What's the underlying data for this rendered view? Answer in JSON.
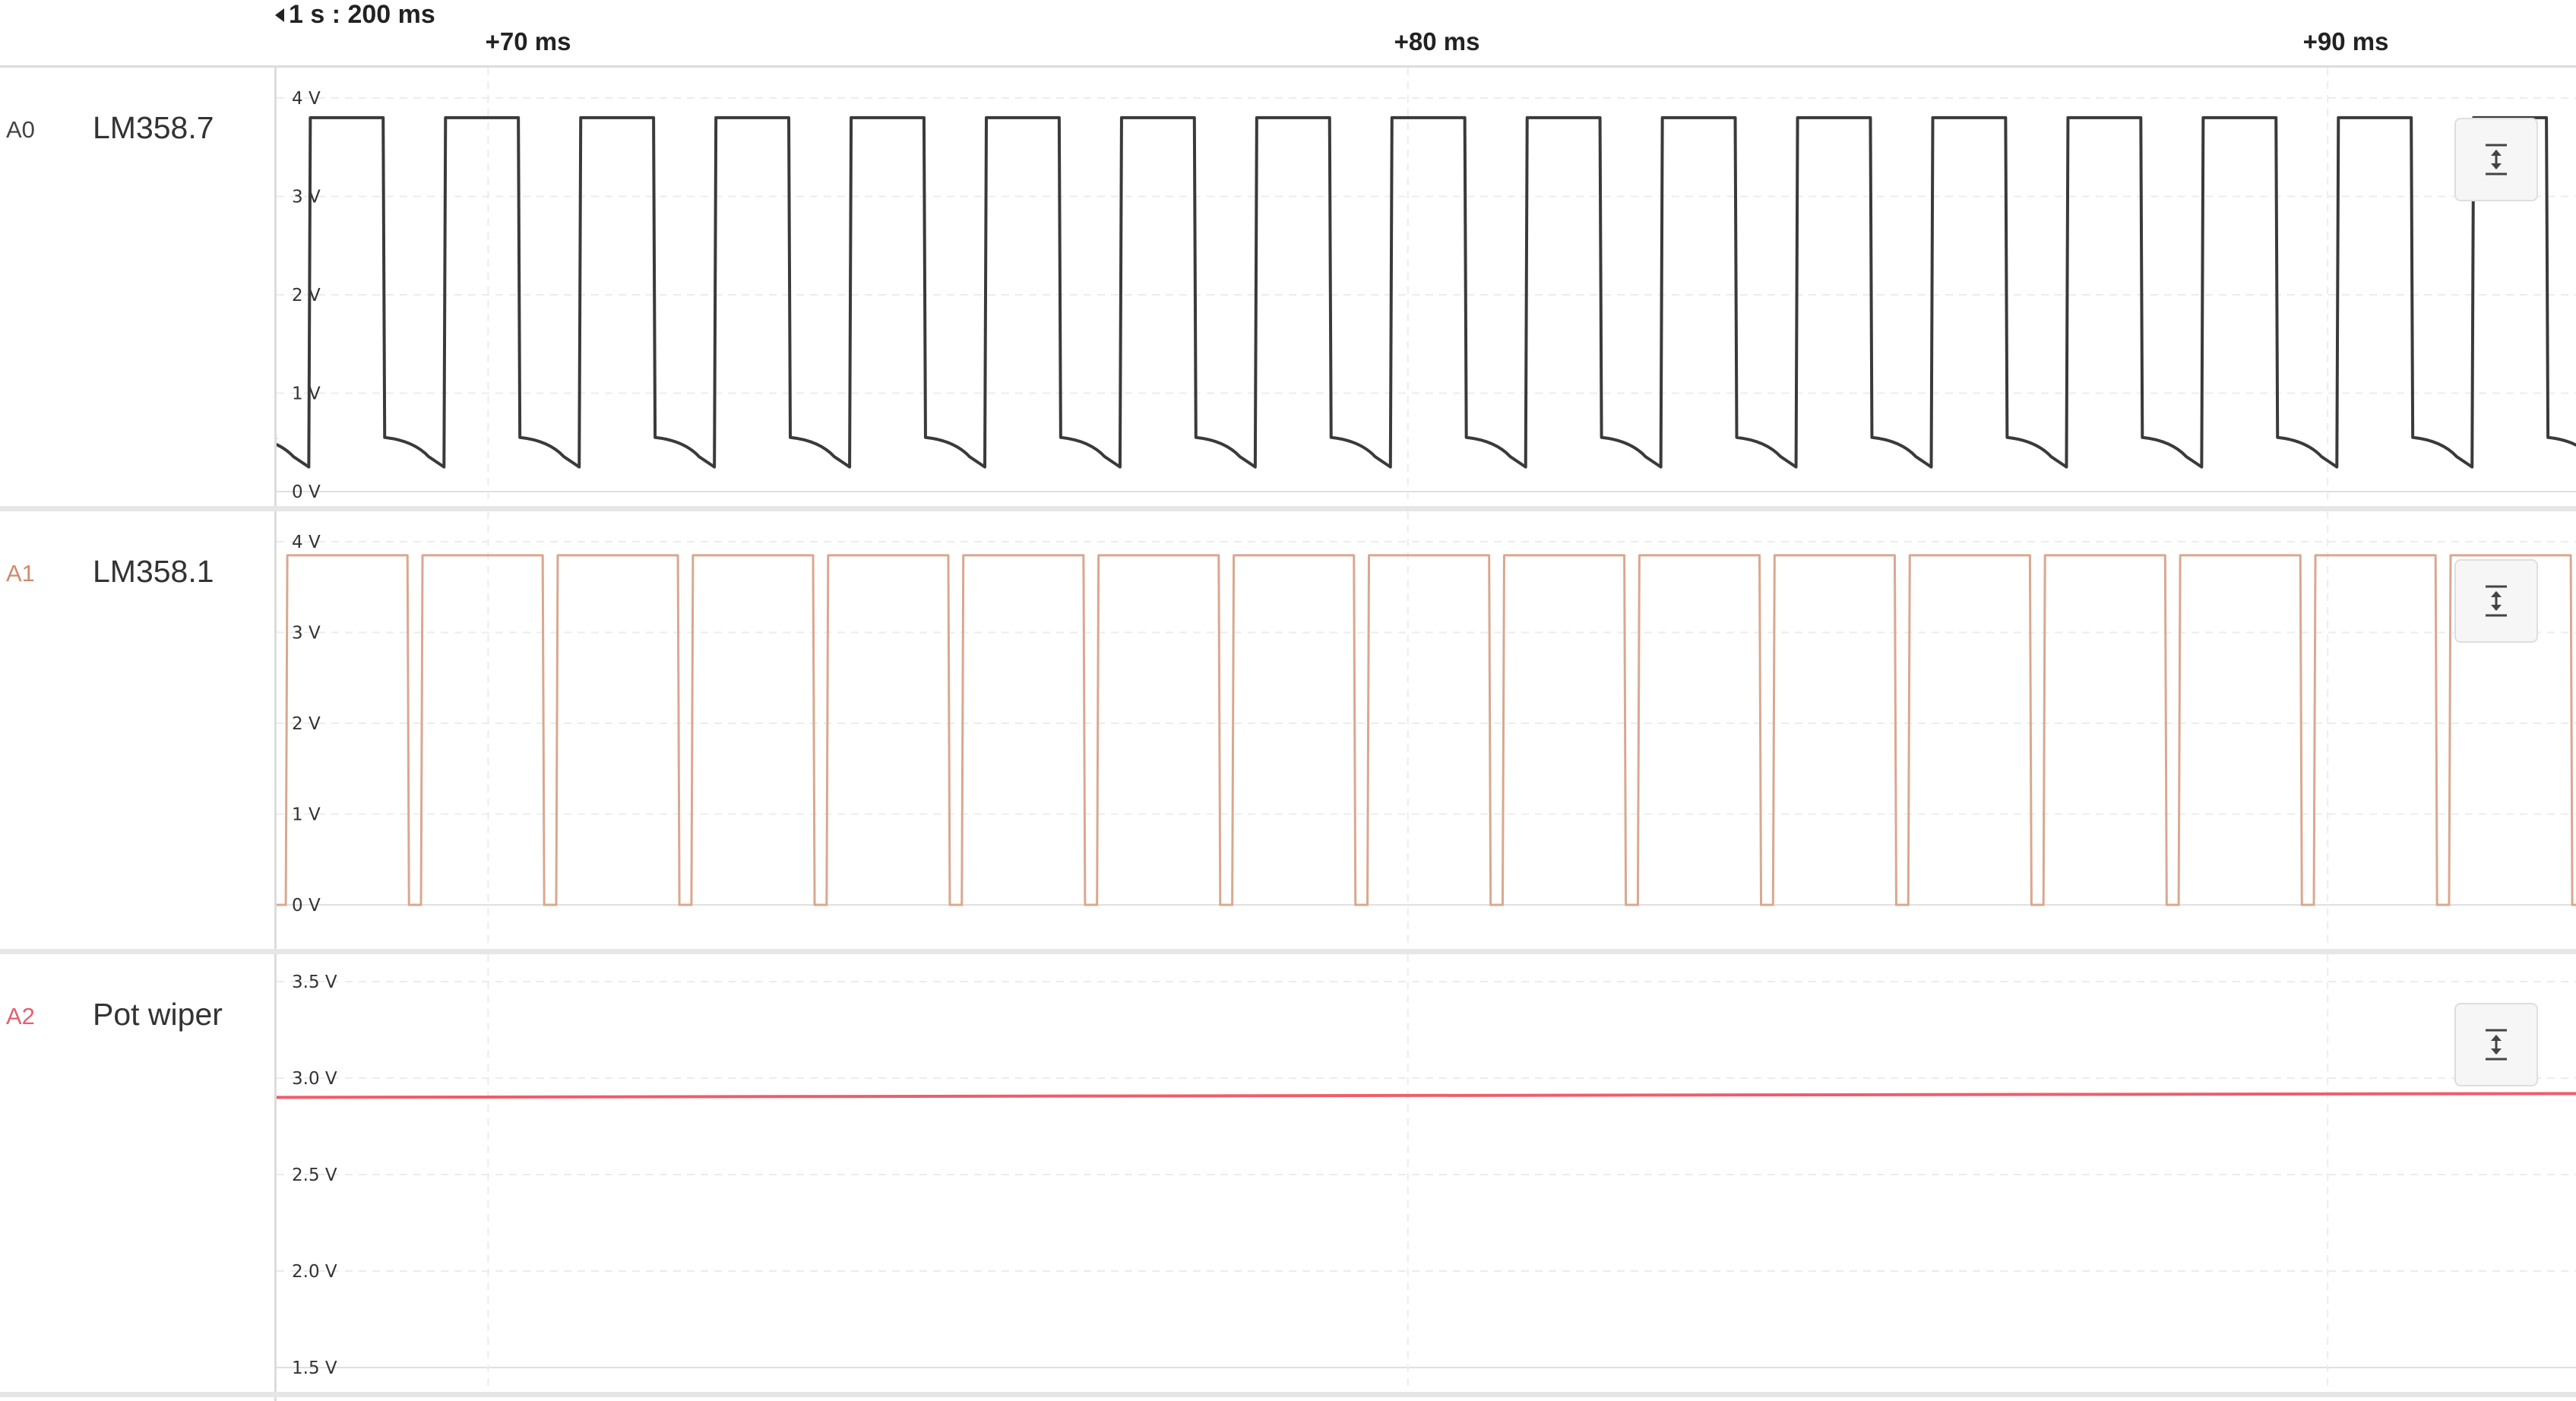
{
  "timeline": {
    "anchor": "1 s : 200 ms",
    "labels": [
      "+70 ms",
      "+80 ms",
      "+90 ms"
    ]
  },
  "colors": {
    "a0": "#3a3a3a",
    "a1": "#d9a88f",
    "a2": "#ef5d6b",
    "a0_id": "#444444",
    "a1_id": "#d08a6d",
    "a2_id": "#e2616e"
  },
  "channels": [
    {
      "id": "A0",
      "name": "LM358.7",
      "ticks": [
        "4 V",
        "3 V",
        "2 V",
        "1 V",
        "0 V"
      ],
      "tick_values": [
        4,
        3,
        2,
        1,
        0
      ],
      "y_range": [
        0,
        4
      ],
      "signal": {
        "type": "square",
        "period_ms": 1.47,
        "high_v": 3.8,
        "low_v": 0.55,
        "low_end_v": 0.25,
        "duty_high": 0.55
      }
    },
    {
      "id": "A1",
      "name": "LM358.1",
      "ticks": [
        "4 V",
        "3 V",
        "2 V",
        "1 V",
        "0 V"
      ],
      "tick_values": [
        4,
        3,
        2,
        1,
        0
      ],
      "y_range": [
        0,
        4
      ],
      "signal": {
        "type": "square",
        "period_ms": 1.47,
        "high_v": 3.85,
        "low_v": 0.0,
        "duty_high": 0.9
      }
    },
    {
      "id": "A2",
      "name": "Pot wiper",
      "ticks": [
        "3.5 V",
        "3.0 V",
        "2.5 V",
        "2.0 V",
        "1.5 V"
      ],
      "tick_values": [
        3.5,
        3.0,
        2.5,
        2.0,
        1.5
      ],
      "y_range": [
        1.5,
        3.5
      ],
      "signal": {
        "type": "flat",
        "start_v": 2.9,
        "end_v": 2.92
      }
    }
  ],
  "time_axis": {
    "start_ms": 67.7,
    "end_ms": 92.7,
    "gridlines_ms": [
      70,
      80,
      90
    ]
  }
}
